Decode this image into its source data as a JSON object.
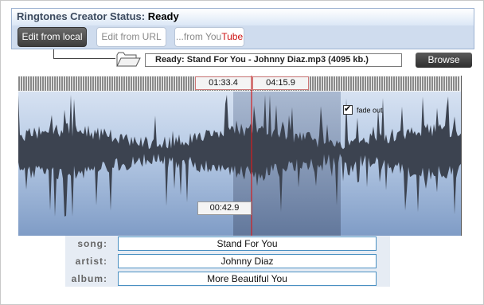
{
  "header": {
    "title_prefix": "Ringtones Creator Status:",
    "status": "Ready"
  },
  "tabs": [
    {
      "label": "Edit from local",
      "active": true
    },
    {
      "label": "Edit from URL",
      "active": false
    },
    {
      "label_prefix": "...from You",
      "label_accent": "Tube",
      "active": false
    }
  ],
  "file": {
    "status_text": "Ready: Stand For You - Johnny Diaz.mp3 (4095 kb.)",
    "browse_label": "Browse"
  },
  "waveform": {
    "selection_start": "01:33.4",
    "selection_end": "04:15.9",
    "cursor_time": "00:42.9",
    "fade_out_label": "fade out",
    "fade_out_checked": true
  },
  "metadata": {
    "song_label": "song:",
    "song_value": "Stand For You",
    "artist_label": "artist:",
    "artist_value": "Johnny Diaz",
    "album_label": "album:",
    "album_value": "More Beautiful You"
  },
  "colors": {
    "accent": "#cc1111",
    "tab_active": "#3d3d3d",
    "field_border": "#4a90c2",
    "wave_fill": "#3c4350"
  }
}
